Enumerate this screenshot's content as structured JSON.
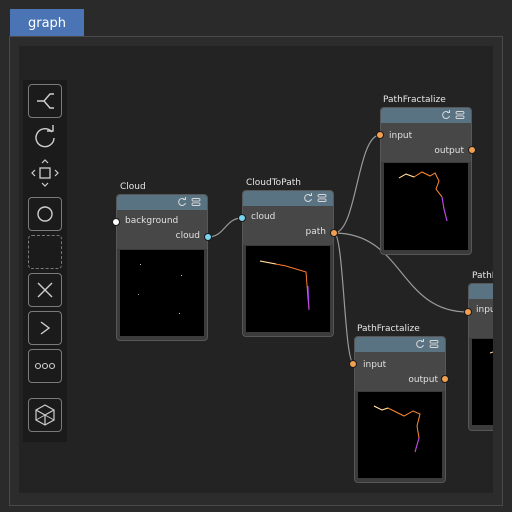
{
  "tab": {
    "label": "graph"
  },
  "colors": {
    "accent": "#4a74b4",
    "port_output": "#f0a050",
    "port_cloud": "#7ad4f0",
    "port_background": "#ffffff",
    "node_header": "#5a7382",
    "wire": "#9a9a9a"
  },
  "toolbar": {
    "tools": [
      {
        "name": "branch-tool-icon"
      },
      {
        "name": "rotate-tool-icon"
      },
      {
        "name": "move-tool-icon"
      },
      {
        "name": "circle-tool-icon"
      },
      {
        "name": "dashed-rect-tool-icon"
      },
      {
        "name": "delete-tool-icon"
      },
      {
        "name": "arrow-tool-icon"
      },
      {
        "name": "more-tool-icon"
      },
      {
        "name": "cube-tool-icon"
      }
    ]
  },
  "nodes": {
    "cloud": {
      "title": "Cloud",
      "input": "background",
      "output": "cloud"
    },
    "cloud_to_path": {
      "title": "CloudToPath",
      "input": "cloud",
      "output": "path"
    },
    "fractalize_top": {
      "title": "PathFractalize",
      "input": "input",
      "output": "output"
    },
    "fractalize_bottom": {
      "title": "PathFractalize",
      "input": "input",
      "output": "output"
    },
    "partial": {
      "title": "PathF",
      "input": "inpu"
    }
  }
}
